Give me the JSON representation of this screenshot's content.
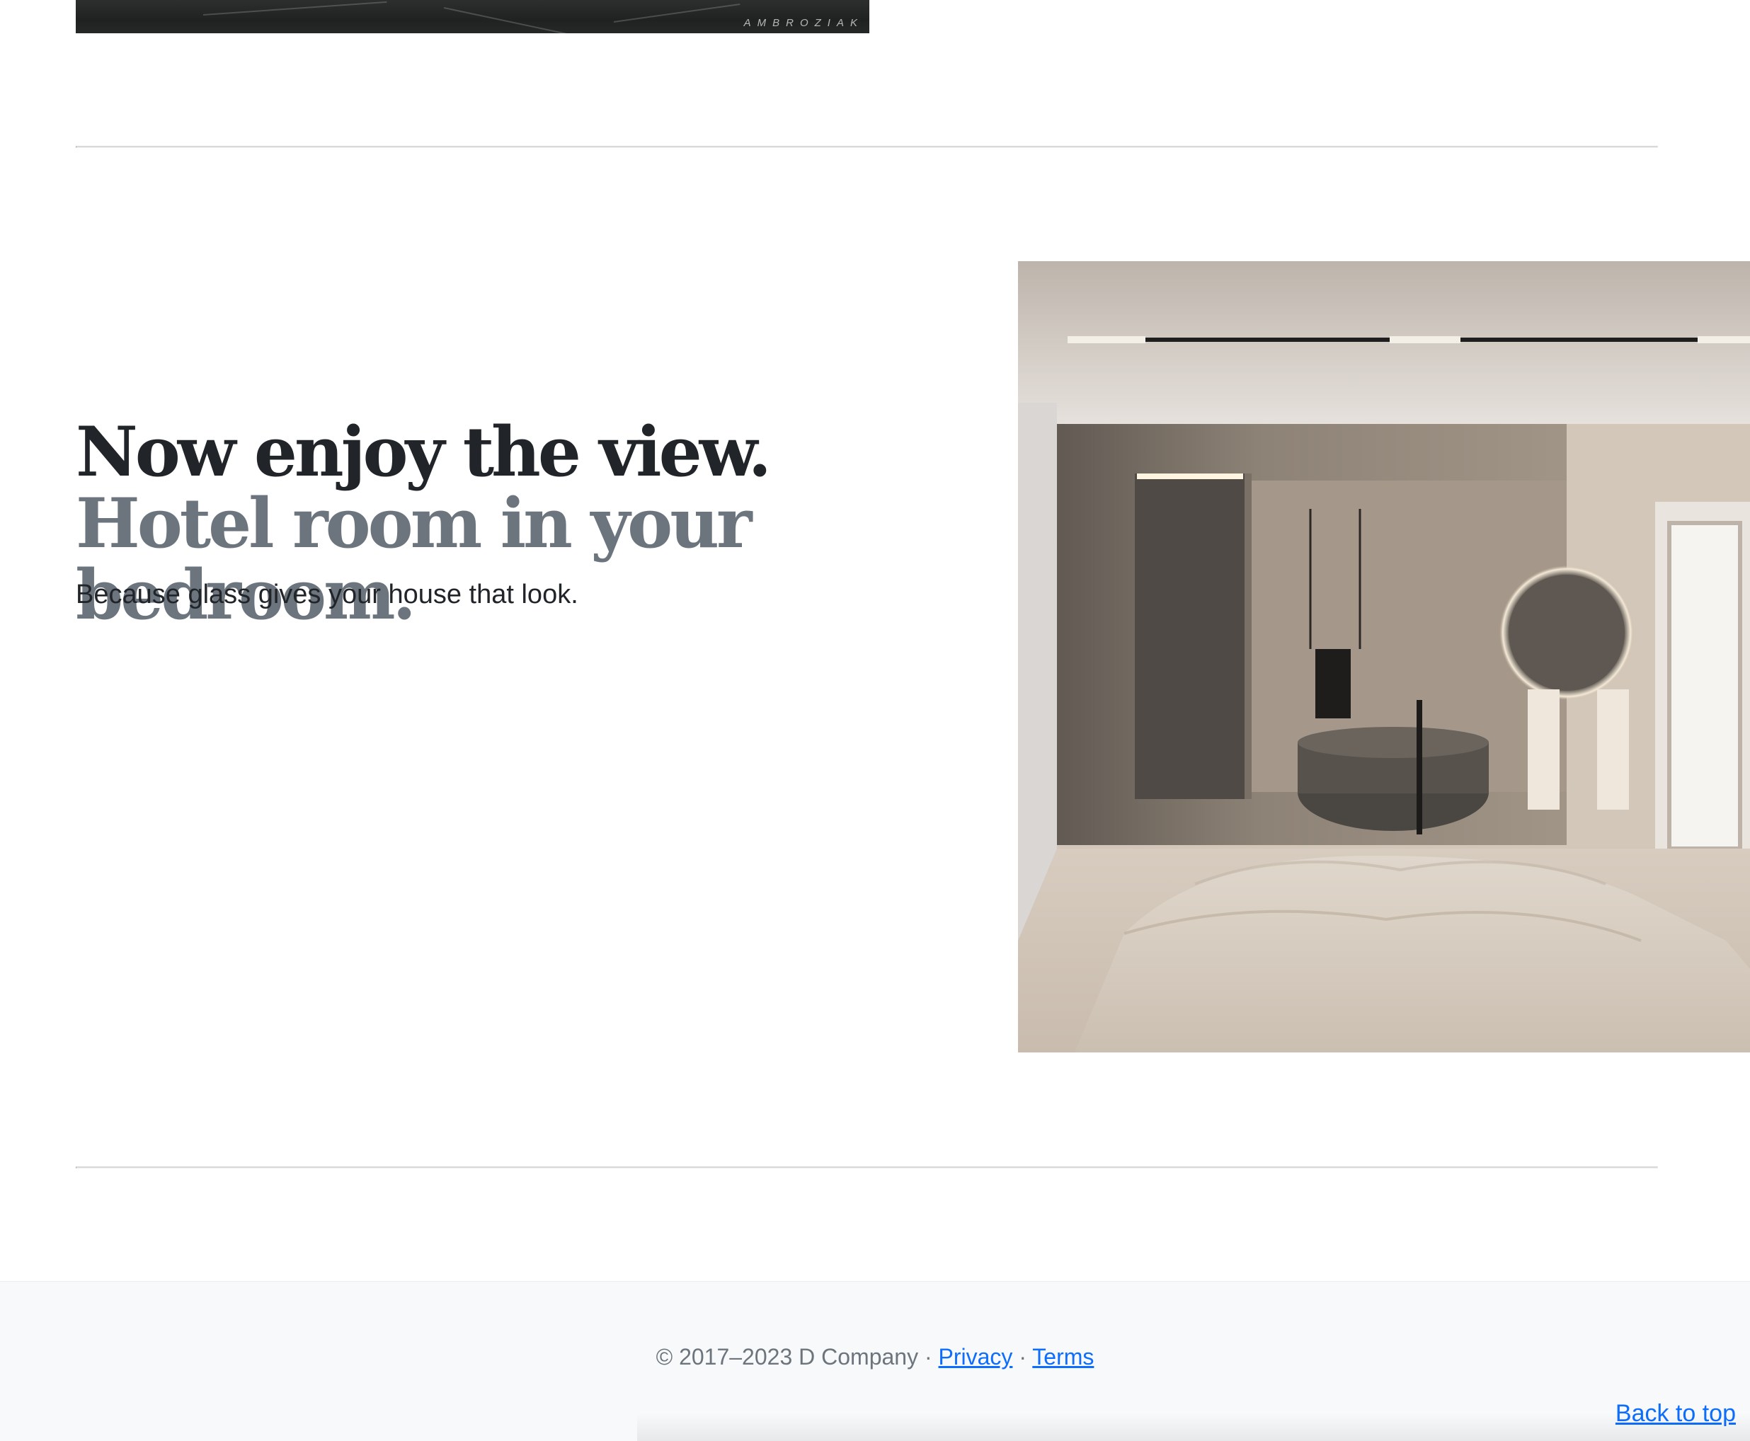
{
  "top_image": {
    "watermark": "AMBROZIAK"
  },
  "feature": {
    "heading_main": "Now enjoy the view.",
    "heading_muted": "Hotel room in your bedroom.",
    "lead": "Because glass gives your house that look."
  },
  "footer": {
    "copyright": "© 2017–2023 D Company",
    "separator": "·",
    "privacy_link": "Privacy",
    "terms_link": "Terms",
    "back_to_top": "Back to top"
  },
  "colors": {
    "text_dark": "#212529",
    "text_muted": "#6c757d",
    "link": "#0d6efd",
    "footer_bg": "#f8f9fa",
    "divider": "#d9d9d9"
  }
}
